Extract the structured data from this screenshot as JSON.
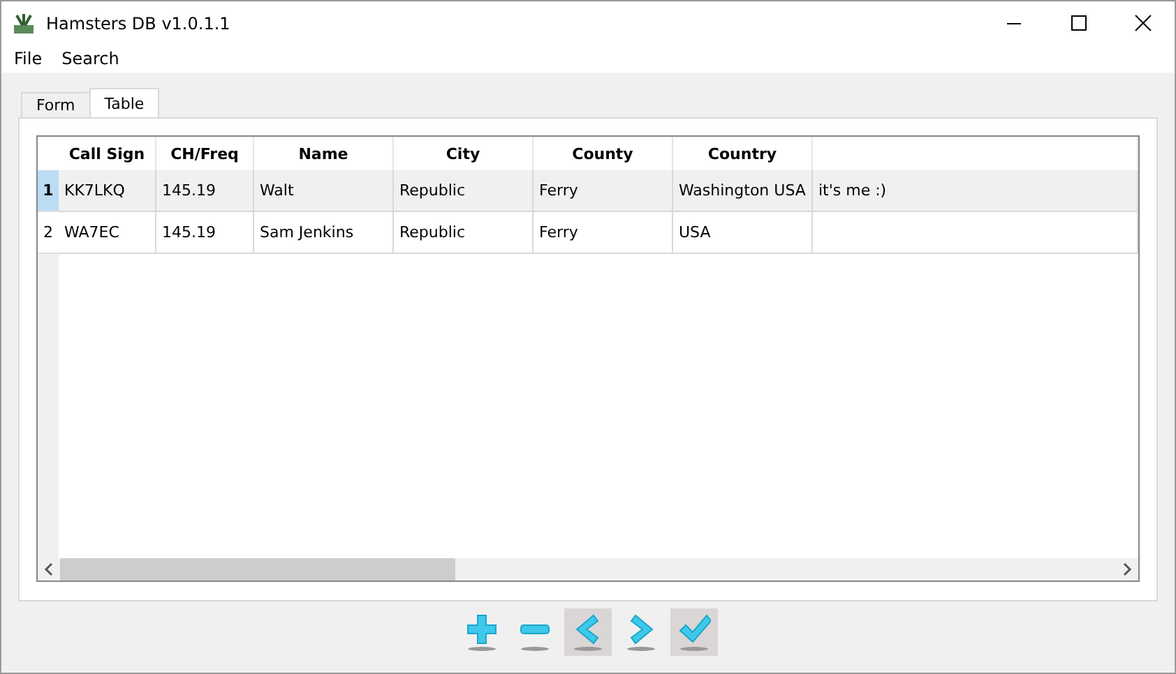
{
  "window": {
    "title": "Hamsters DB v1.0.1.1"
  },
  "menu": [
    "File",
    "Search"
  ],
  "tabs": [
    {
      "label": "Form",
      "selected": false
    },
    {
      "label": "Table",
      "selected": true
    }
  ],
  "table": {
    "columns": [
      "Call Sign",
      "CH/Freq",
      "Name",
      "City",
      "County",
      "Country"
    ],
    "rows": [
      {
        "number": "1",
        "selected": true,
        "cells": [
          "KK7LKQ",
          "145.19",
          "Walt",
          "Republic",
          "Ferry",
          "Washington USA",
          "it's me :)"
        ]
      },
      {
        "number": "2",
        "selected": false,
        "cells": [
          "WA7EC",
          "145.19",
          "Sam Jenkins",
          "Republic",
          "Ferry",
          "USA"
        ]
      }
    ]
  },
  "toolbar": [
    {
      "kind": "add",
      "highlighted": false
    },
    {
      "kind": "remove",
      "highlighted": false
    },
    {
      "kind": "previous",
      "highlighted": true
    },
    {
      "kind": "next",
      "highlighted": false
    },
    {
      "kind": "confirm",
      "highlighted": true
    }
  ]
}
